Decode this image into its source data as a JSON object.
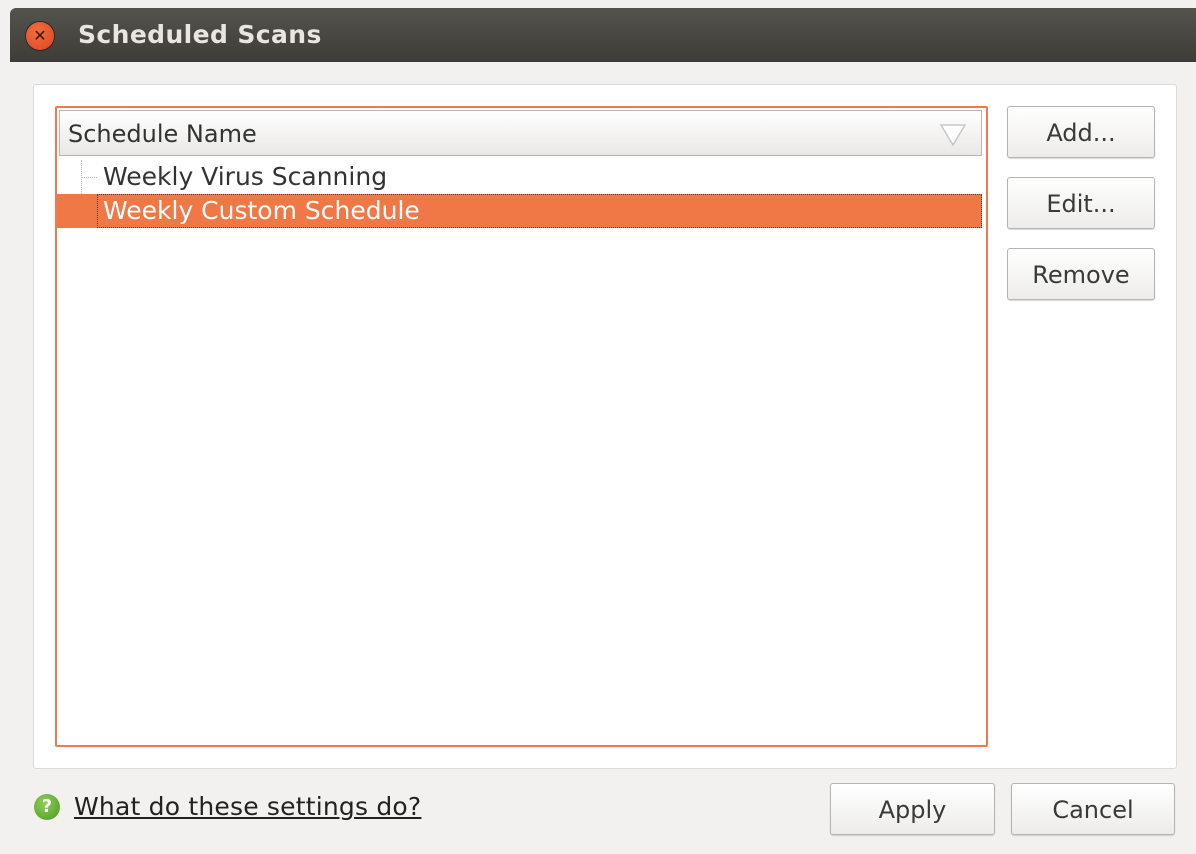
{
  "window": {
    "title": "Scheduled Scans"
  },
  "tree": {
    "column_header": "Schedule Name",
    "rows": [
      {
        "label": "Weekly Virus Scanning",
        "selected": false
      },
      {
        "label": "Weekly Custom Schedule",
        "selected": true
      }
    ]
  },
  "side_buttons": {
    "add_label": "Add...",
    "edit_label": "Edit...",
    "remove_label": "Remove"
  },
  "footer": {
    "help_link": "What do these settings do?",
    "apply_label": "Apply",
    "cancel_label": "Cancel"
  },
  "colors": {
    "accent": "#f07846",
    "titlebar": "#3d3c37",
    "close_button": "#e2552a",
    "help_icon": "#5aa82c"
  },
  "icons": [
    "close-icon",
    "sort-arrow-icon",
    "help-icon"
  ]
}
